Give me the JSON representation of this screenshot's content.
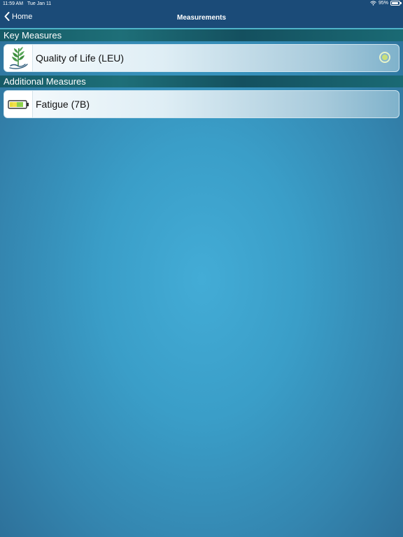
{
  "status_bar": {
    "time": "11:59 AM",
    "date": "Tue Jan 11",
    "battery": "95%"
  },
  "navbar": {
    "back_label": "Home",
    "title": "Measurements"
  },
  "sections": {
    "key": {
      "header": "Key Measures",
      "items": [
        {
          "label": "Quality of Life (LEU)",
          "icon": "plant-in-hand-icon",
          "selected": true
        }
      ]
    },
    "additional": {
      "header": "Additional Measures",
      "items": [
        {
          "label": "Fatigue (7B)",
          "icon": "battery-level-icon"
        }
      ]
    }
  },
  "colors": {
    "nav_background": "#1b4b78",
    "section_header": "#1e6f78",
    "background_center": "#43acd6",
    "background_edge": "#2d6e97",
    "radio_accent": "#c8e07a"
  }
}
